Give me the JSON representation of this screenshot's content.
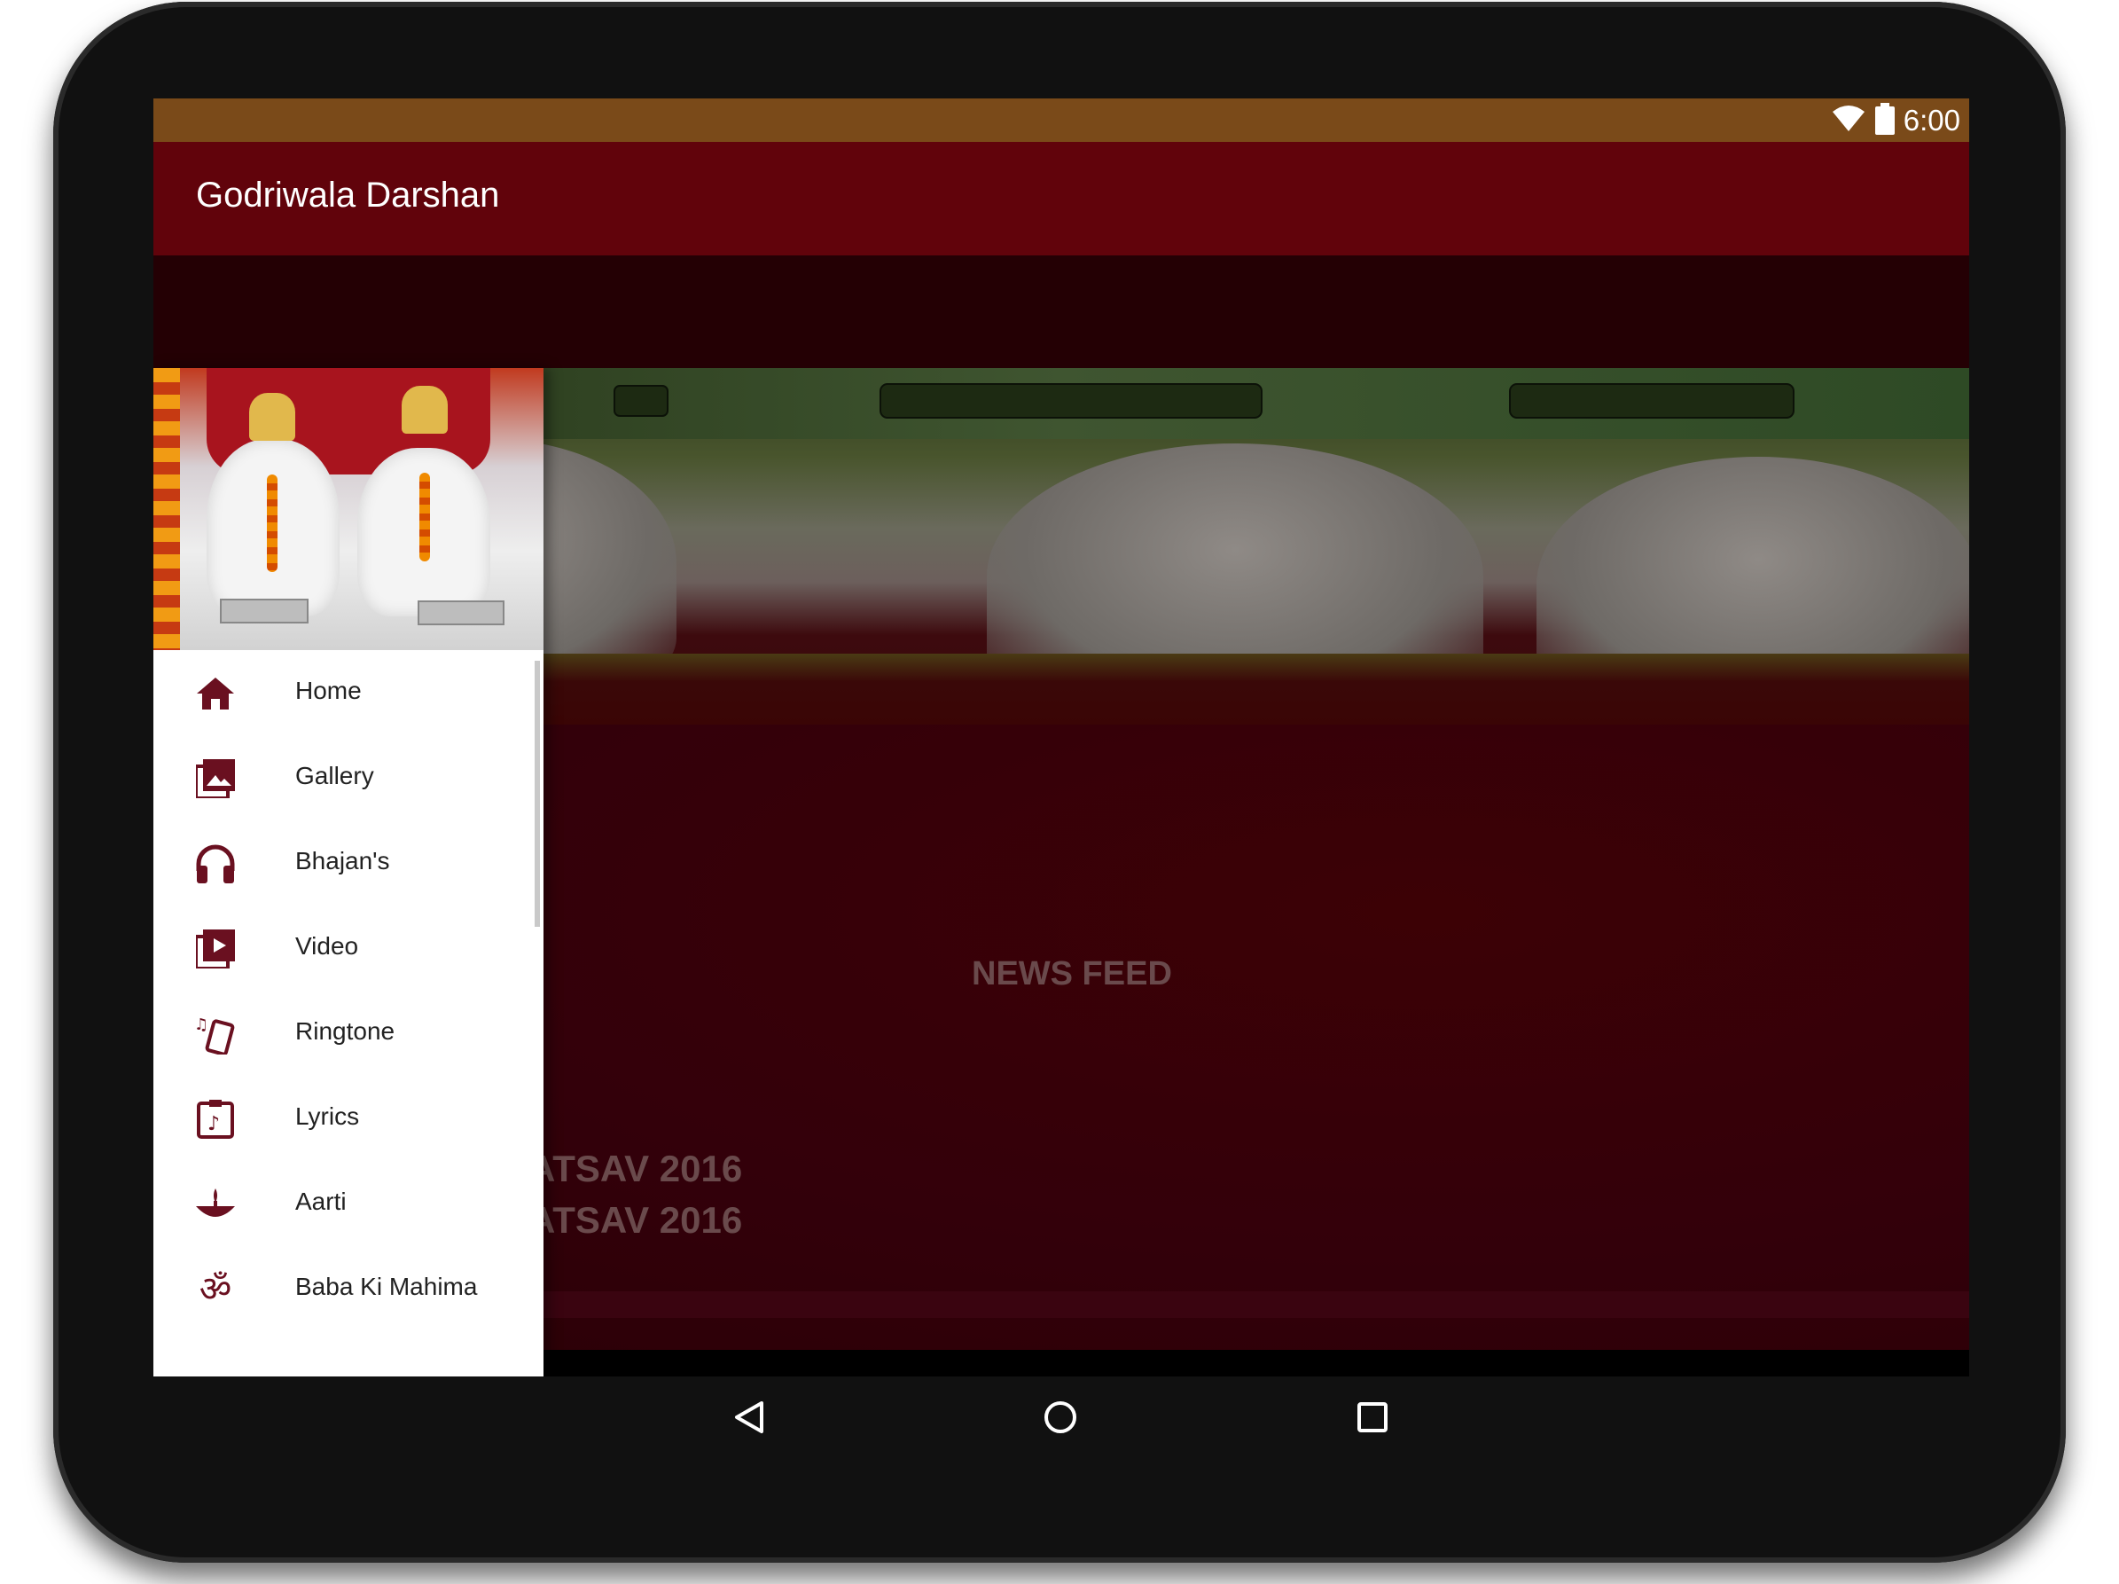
{
  "status_bar": {
    "time": "6:00",
    "wifi_icon": "wifi-icon",
    "battery_icon": "battery-icon"
  },
  "app_bar": {
    "title": "Godriwala Darshan"
  },
  "drawer": {
    "header_image": "drawer-header-image",
    "items": [
      {
        "label": "Home",
        "icon": "home-icon"
      },
      {
        "label": "Gallery",
        "icon": "gallery-icon"
      },
      {
        "label": "Bhajan's",
        "icon": "headphones-icon"
      },
      {
        "label": "Video",
        "icon": "video-library-icon"
      },
      {
        "label": "Ringtone",
        "icon": "ringtone-icon"
      },
      {
        "label": "Lyrics",
        "icon": "lyrics-icon"
      },
      {
        "label": "Aarti",
        "icon": "aarti-icon"
      },
      {
        "label": "Baba Ki Mahima",
        "icon": "om-icon"
      }
    ]
  },
  "content": {
    "news_feed_title": "NEWS FEED",
    "news_items": [
      "ATSAV 2016",
      "ATSAV 2016"
    ]
  },
  "nav_bar": {
    "back": "back-icon",
    "home": "home-nav-icon",
    "recents": "recents-icon"
  },
  "colors": {
    "status_bar": "#7a4a19",
    "app_bar": "#61030b",
    "accent_icon": "#6a1020"
  }
}
